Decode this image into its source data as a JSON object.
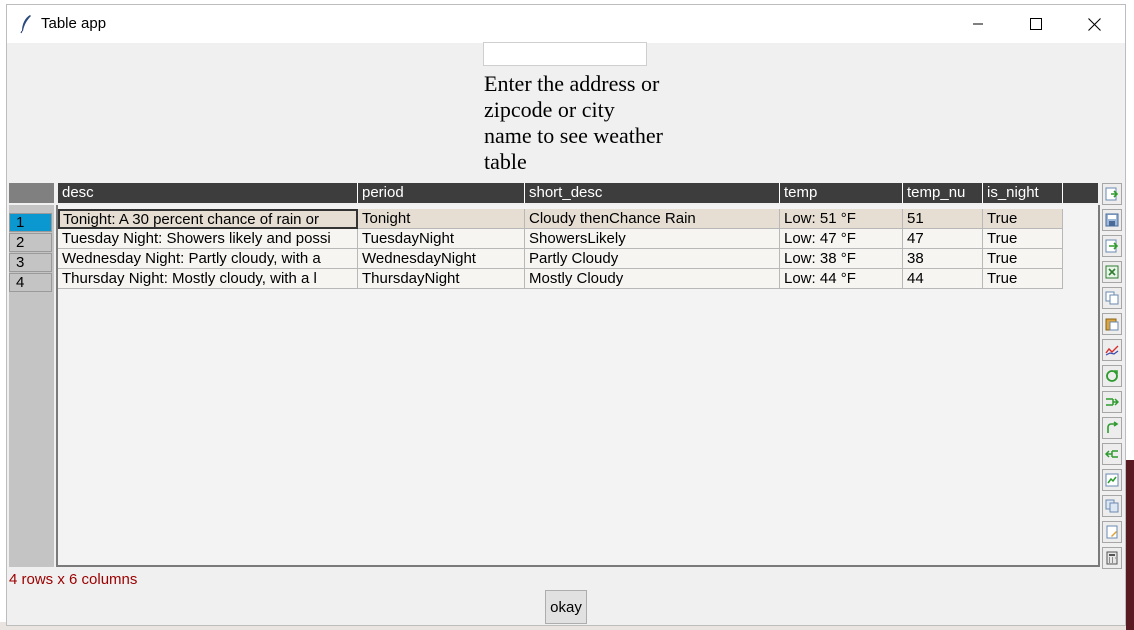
{
  "window": {
    "title": "Table app",
    "minimize_glyph": "─",
    "maximize_glyph": "☐",
    "close_glyph": "✕"
  },
  "search": {
    "value": "",
    "prompt": "Enter the address or zipcode or city name to see weather table"
  },
  "table": {
    "columns": [
      "desc",
      "period",
      "short_desc",
      "temp",
      "temp_nu",
      "is_night"
    ],
    "row_numbers": [
      "1",
      "2",
      "3",
      "4"
    ],
    "selected_row": 1,
    "rows": [
      [
        "Tonight: A 30 percent chance of rain or",
        "Tonight",
        "Cloudy thenChance Rain",
        "Low: 51 °F",
        "51",
        "True"
      ],
      [
        "Tuesday Night: Showers likely and possi",
        "TuesdayNight",
        "ShowersLikely",
        "Low: 47 °F",
        "47",
        "True"
      ],
      [
        "Wednesday Night: Partly cloudy, with a",
        "WednesdayNight",
        "Partly Cloudy",
        "Low: 38 °F",
        "38",
        "True"
      ],
      [
        "Thursday Night: Mostly cloudy, with a l",
        "ThursdayNight",
        "Mostly Cloudy",
        "Low: 44 °F",
        "44",
        "True"
      ]
    ]
  },
  "toolbar": {
    "icons": [
      "import-icon",
      "save-icon",
      "export-icon",
      "excel-icon",
      "copy-icon",
      "paste-icon",
      "plot-icon",
      "transpose-icon",
      "aggregate-icon",
      "pivot-icon",
      "melt-icon",
      "merge-icon",
      "query-icon",
      "evaluate-icon",
      "calculator-icon"
    ]
  },
  "status": {
    "text": "4 rows x 6 columns"
  },
  "footer": {
    "okay_label": "okay"
  },
  "colors": {
    "header_bg": "#3d3d3d",
    "selected_row_number": "#0b97d0",
    "selected_row_bg": "#e6ded3",
    "status_text": "#9b0000"
  }
}
